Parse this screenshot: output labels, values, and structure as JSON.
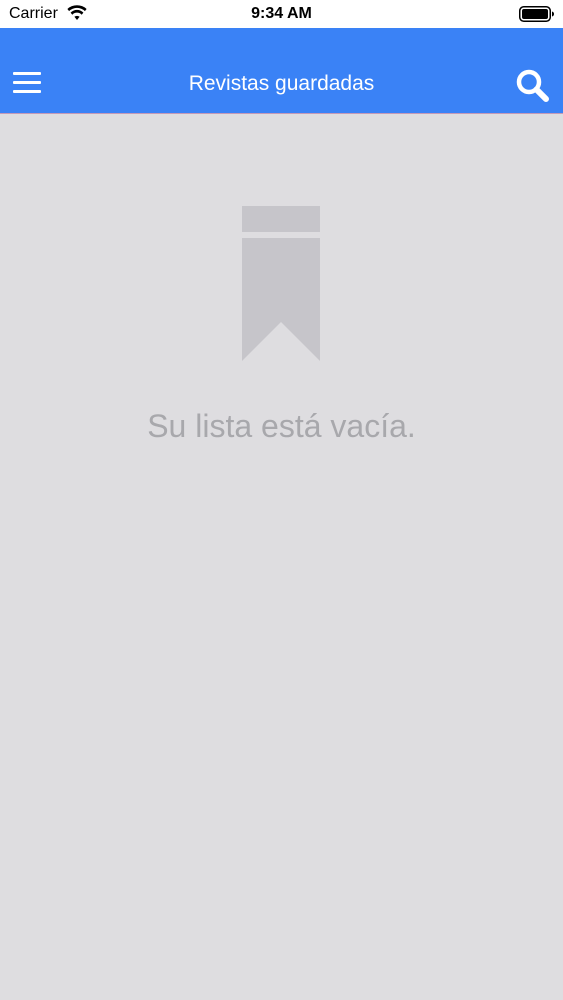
{
  "status_bar": {
    "carrier": "Carrier",
    "time": "9:34 AM",
    "icons": [
      "wifi-icon",
      "battery-icon"
    ]
  },
  "nav_bar": {
    "title": "Revistas guardadas",
    "left_icon": "hamburger-menu-icon",
    "right_icon": "search-icon",
    "background_color": "#3a82f6"
  },
  "empty_state": {
    "icon": "bookmark-icon",
    "message": "Su lista está vacía."
  },
  "colors": {
    "accent": "#3a82f6",
    "background": "#dedde0",
    "muted_text": "#a8a8ac",
    "icon_gray": "#c6c5ca"
  }
}
